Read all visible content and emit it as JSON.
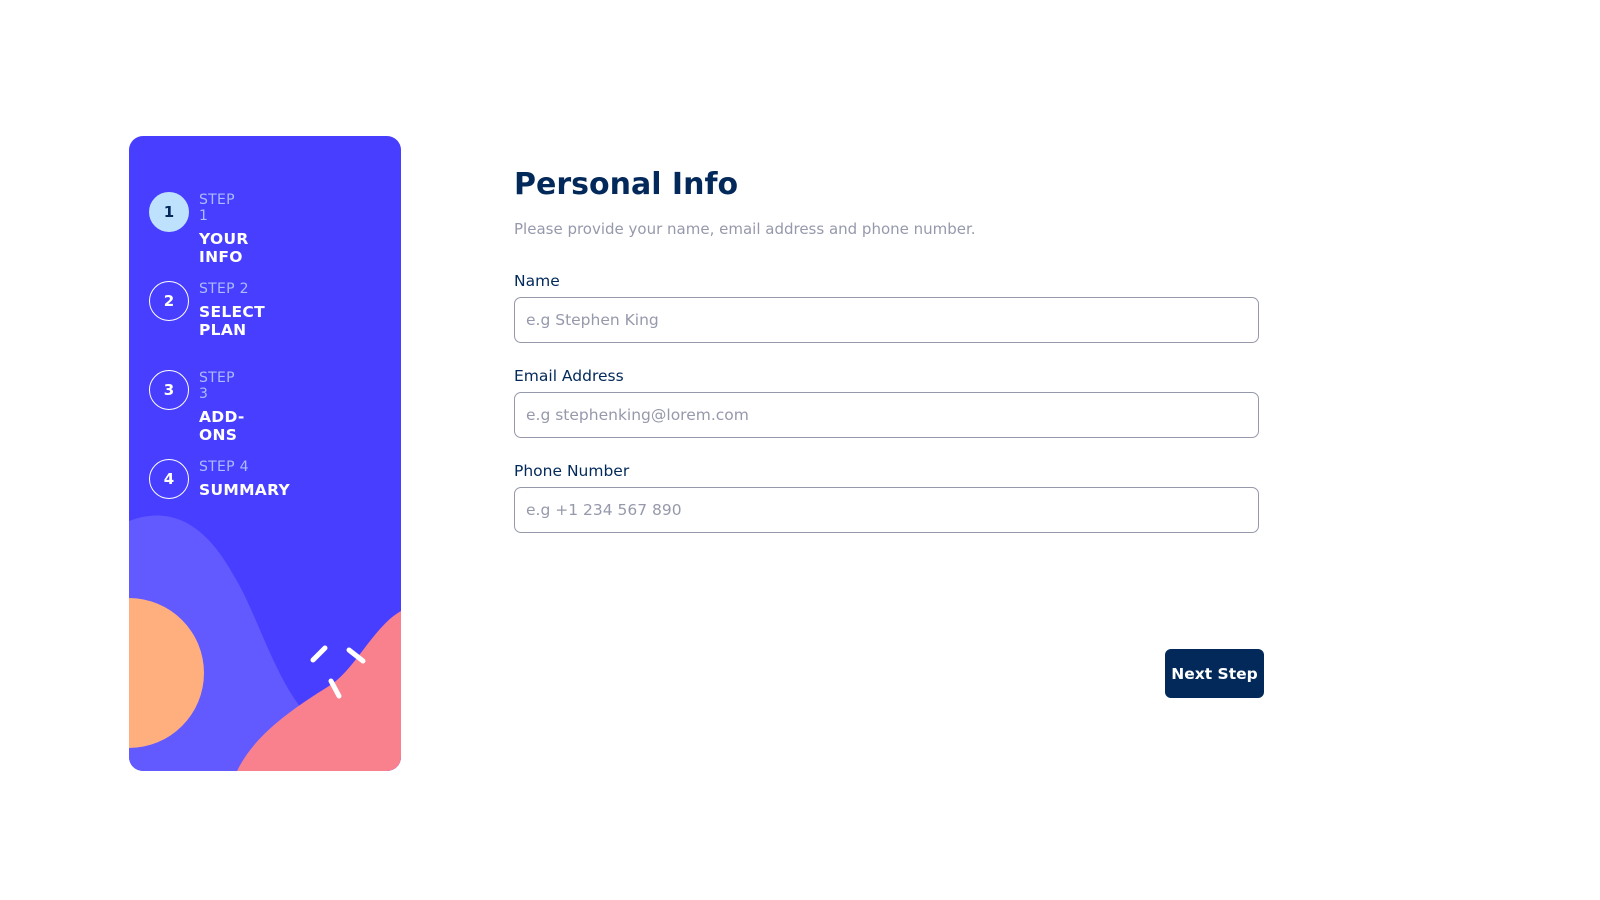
{
  "sidebar": {
    "steps": [
      {
        "number": "1",
        "label": "STEP 1",
        "title": "YOUR INFO"
      },
      {
        "number": "2",
        "label": "STEP 2",
        "title": "SELECT PLAN"
      },
      {
        "number": "3",
        "label": "STEP 3",
        "title": "ADD-ONS"
      },
      {
        "number": "4",
        "label": "STEP 4",
        "title": "SUMMARY"
      }
    ],
    "active_step": 1
  },
  "main": {
    "title": "Personal Info",
    "subtitle": "Please provide your name, email address and phone number.",
    "fields": [
      {
        "label": "Name",
        "placeholder": "e.g Stephen King",
        "value": ""
      },
      {
        "label": "Email Address",
        "placeholder": "e.g stephenking@lorem.com",
        "value": ""
      },
      {
        "label": "Phone Number",
        "placeholder": "e.g +1 234 567 890",
        "value": ""
      }
    ],
    "next_button": "Next Step"
  },
  "colors": {
    "sidebar_bg": "#483eff",
    "active_step_bg": "#bee2fd",
    "primary_text": "#02295a",
    "muted_text": "#9699ab",
    "decor_orange": "#ffaf7e",
    "decor_pink": "#f9818e",
    "decor_purple": "#6259ff"
  }
}
